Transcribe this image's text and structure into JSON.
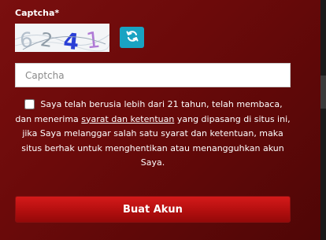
{
  "captcha": {
    "label": "Captcha*",
    "image_text": "6241",
    "refresh_icon": "refresh-icon",
    "input_placeholder": "Captcha",
    "input_value": ""
  },
  "terms": {
    "checked": false,
    "text_before": "Saya telah berusia lebih dari 21 tahun, telah membaca, dan menerima ",
    "link_text": "syarat dan ketentuan",
    "text_after": " yang dipasang di situs ini, jika Saya melanggar salah satu syarat dan ketentuan, maka situs berhak untuk menghentikan atau menangguhkan akun Saya."
  },
  "submit": {
    "label": "Buat Akun"
  },
  "colors": {
    "background": "#6b0a0a",
    "refresh_button": "#19a3c2",
    "submit_button": "#c01212"
  }
}
